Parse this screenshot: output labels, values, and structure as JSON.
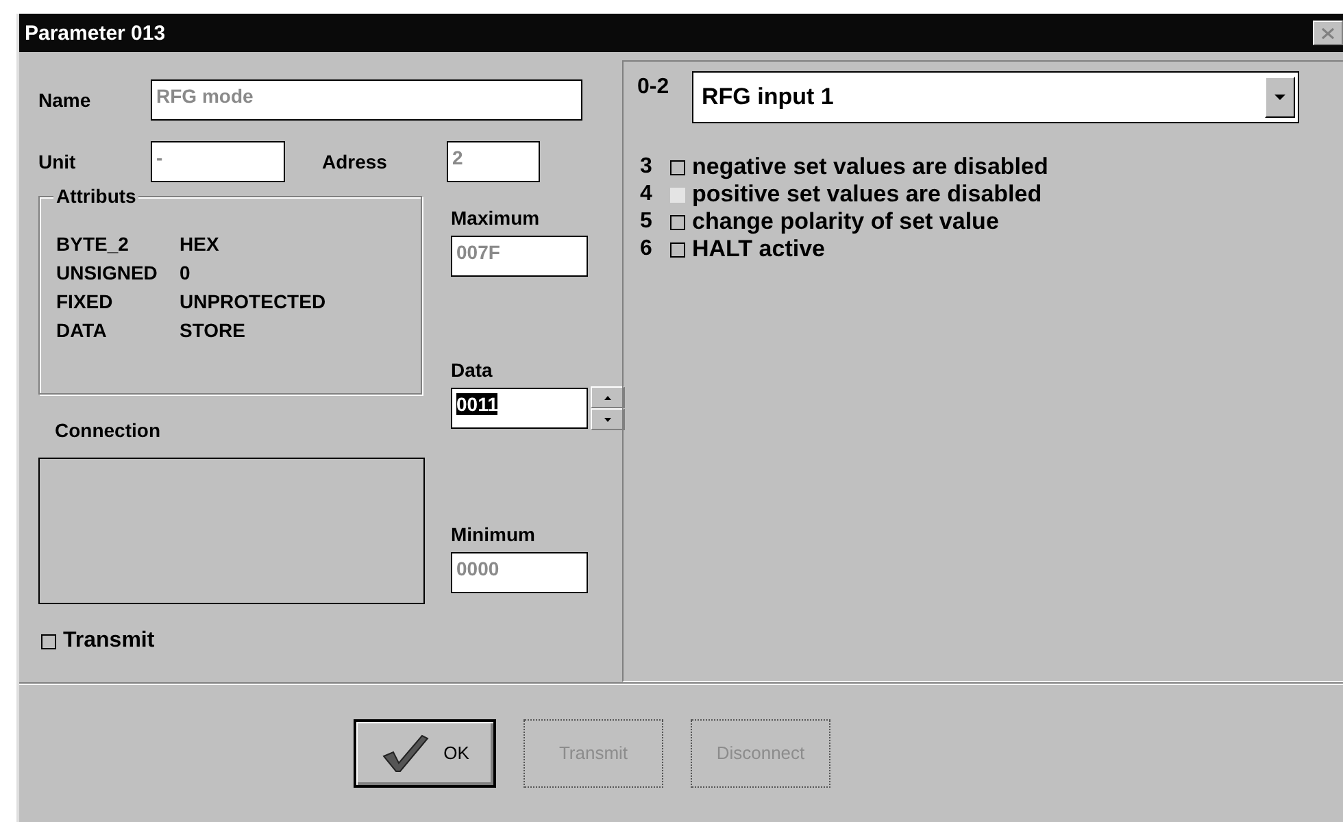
{
  "window": {
    "title": "Parameter 013"
  },
  "name": {
    "label": "Name",
    "value": "RFG mode",
    "disabled": true
  },
  "unit": {
    "label": "Unit",
    "value": "-",
    "disabled": true
  },
  "address": {
    "label": "Adress",
    "value": "2",
    "disabled": true
  },
  "attributes": {
    "title": "Attributs",
    "rows": [
      [
        "BYTE_2",
        "HEX"
      ],
      [
        "UNSIGNED",
        "0"
      ],
      [
        "FIXED",
        "UNPROTECTED"
      ],
      [
        "DATA",
        "STORE"
      ]
    ]
  },
  "maximum": {
    "label": "Maximum",
    "value": "007F",
    "disabled": true
  },
  "data": {
    "label": "Data",
    "value": "0011",
    "disabled": false,
    "highlighted": true
  },
  "minimum": {
    "label": "Minimum",
    "value": "0000",
    "disabled": true
  },
  "connection": {
    "label": "Connection"
  },
  "transmit": {
    "label": "Transmit",
    "checked": false,
    "disabled": false
  },
  "bits": {
    "select": {
      "index": "0-2",
      "value": "RFG input 1"
    },
    "flags": [
      {
        "index": "3",
        "label": "negative set values are disabled",
        "checked": false,
        "disabled": false
      },
      {
        "index": "4",
        "label": "positive set values are disabled",
        "checked": false,
        "disabled": true
      },
      {
        "index": "5",
        "label": "change polarity of set value",
        "checked": false,
        "disabled": false
      },
      {
        "index": "6",
        "label": "HALT active",
        "checked": false,
        "disabled": false
      }
    ]
  },
  "buttons": [
    {
      "label": "OK",
      "kind": "ok",
      "default": true,
      "disabled": false
    },
    {
      "label": "Transmit",
      "kind": "plain",
      "default": false,
      "disabled": true
    },
    {
      "label": "Disconnect",
      "kind": "plain",
      "default": false,
      "disabled": true
    }
  ]
}
